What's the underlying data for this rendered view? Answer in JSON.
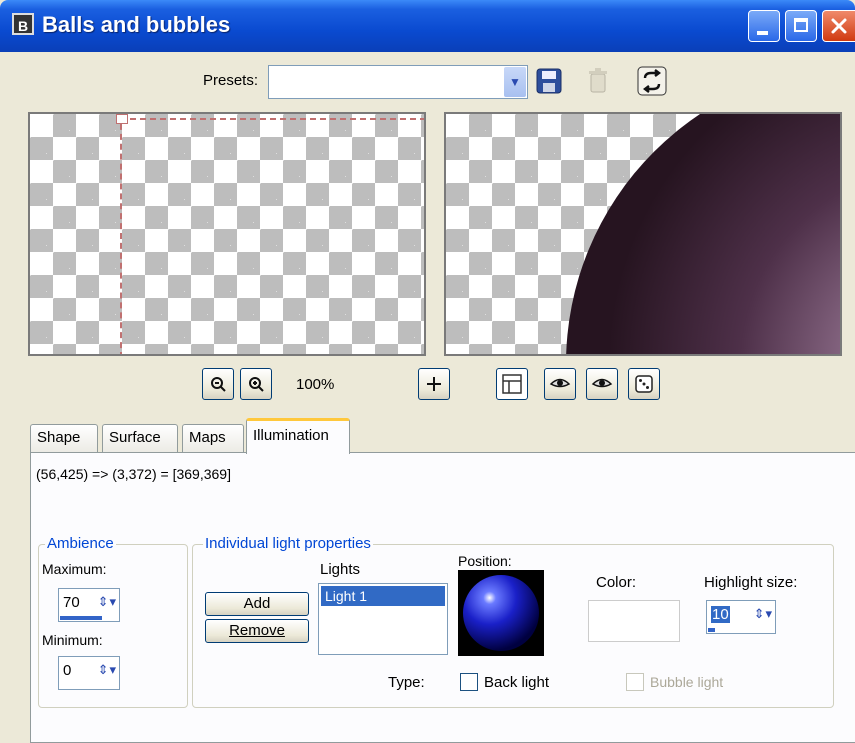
{
  "window": {
    "title": "Balls and bubbles",
    "icon_letter": "B"
  },
  "presets": {
    "label": "Presets:",
    "value": ""
  },
  "preview": {
    "zoom": "100%"
  },
  "tabs": [
    {
      "label": "Shape"
    },
    {
      "label": "Surface"
    },
    {
      "label": "Maps"
    },
    {
      "label": "Illumination",
      "active": true
    }
  ],
  "illumination": {
    "coordinates": "(56,425) => (3,372) = [369,369]",
    "ambience": {
      "legend": "Ambience",
      "maximum_label": "Maximum:",
      "maximum_value": "70",
      "maximum_fraction": 0.7,
      "minimum_label": "Minimum:",
      "minimum_value": "0"
    },
    "light": {
      "legend": "Individual light properties",
      "add_label": "Add",
      "remove_label": "Remove",
      "lights_label": "Lights",
      "lights": [
        "Light 1"
      ],
      "position_label": "Position:",
      "color_label": "Color:",
      "highlight_label": "Highlight size:",
      "highlight_value": "10",
      "highlight_fraction": 0.1,
      "type_label": "Type:",
      "back_light_label": "Back light",
      "bubble_light_label": "Bubble light"
    }
  },
  "colors": {
    "titlebar": "#0a4ad0",
    "selection": "#316ac5",
    "group_legend": "#0046d5",
    "ball": "#5a3a55"
  }
}
